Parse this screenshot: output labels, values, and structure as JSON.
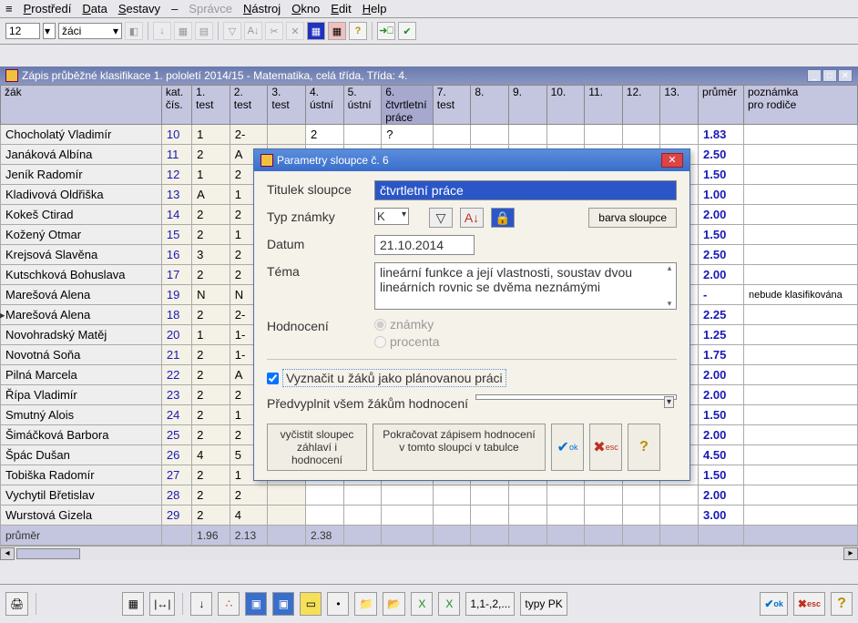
{
  "menu": [
    "Prostředí",
    "Data",
    "Sestavy",
    "–",
    "Správce",
    "Nástroj",
    "Okno",
    "Edit",
    "Help"
  ],
  "toolbar": {
    "num": "12",
    "drop": "žáci"
  },
  "subwindow_title": "Zápis průběžné klasifikace 1. pololetí 2014/15 - Matematika, celá třída, Třída: 4.",
  "columns": [
    "žák",
    "kat. čís.",
    "1. test",
    "2. test",
    "3. test",
    "4. ústní",
    "5. ústní",
    "6. čtvrtletní práce",
    "7. test",
    "8.",
    "9.",
    "10.",
    "11.",
    "12.",
    "13.",
    "průměr",
    "poznámka pro rodiče"
  ],
  "rows": [
    {
      "name": "Chocholatý Vladimír",
      "kat": "10",
      "g": [
        "1",
        "2-",
        "",
        "2",
        "",
        "?",
        "",
        "",
        "",
        "",
        "",
        "",
        ""
      ],
      "avg": "1.83",
      "note": ""
    },
    {
      "name": "Janáková Albína",
      "kat": "11",
      "g": [
        "2",
        "A",
        "",
        "",
        "",
        "",
        "",
        "",
        "",
        "",
        "",
        "",
        ""
      ],
      "avg": "2.50",
      "note": ""
    },
    {
      "name": "Jeník Radomír",
      "kat": "12",
      "g": [
        "1",
        "2",
        "",
        "",
        "",
        "",
        "",
        "",
        "",
        "",
        "",
        "",
        ""
      ],
      "avg": "1.50",
      "note": ""
    },
    {
      "name": "Kladivová Oldřiška",
      "kat": "13",
      "g": [
        "A",
        "1",
        "",
        "",
        "",
        "",
        "",
        "",
        "",
        "",
        "",
        "",
        ""
      ],
      "avg": "1.00",
      "note": ""
    },
    {
      "name": "Kokeš Ctirad",
      "kat": "14",
      "g": [
        "2",
        "2",
        "",
        "",
        "",
        "",
        "",
        "",
        "",
        "",
        "",
        "",
        ""
      ],
      "avg": "2.00",
      "note": ""
    },
    {
      "name": "Kožený Otmar",
      "kat": "15",
      "g": [
        "2",
        "1",
        "",
        "",
        "",
        "",
        "",
        "",
        "",
        "",
        "",
        "",
        ""
      ],
      "avg": "1.50",
      "note": ""
    },
    {
      "name": "Krejsová Slavěna",
      "kat": "16",
      "g": [
        "3",
        "2",
        "",
        "",
        "",
        "",
        "",
        "",
        "",
        "",
        "",
        "",
        ""
      ],
      "avg": "2.50",
      "note": ""
    },
    {
      "name": "Kutschková Bohuslava",
      "kat": "17",
      "g": [
        "2",
        "2",
        "",
        "",
        "",
        "",
        "",
        "",
        "",
        "",
        "",
        "",
        ""
      ],
      "avg": "2.00",
      "note": ""
    },
    {
      "name": "Marešová Alena",
      "kat": "19",
      "g": [
        "N",
        "N",
        "",
        "",
        "",
        "",
        "",
        "",
        "",
        "",
        "",
        "",
        ""
      ],
      "avg": "-",
      "note": "nebude klasifikována"
    },
    {
      "name": "Marešová Alena",
      "kat": "18",
      "g": [
        "2",
        "2-",
        "",
        "",
        "",
        "",
        "",
        "",
        "",
        "",
        "",
        "",
        ""
      ],
      "avg": "2.25",
      "note": ""
    },
    {
      "name": "Novohradský Matěj",
      "kat": "20",
      "g": [
        "1",
        "1-",
        "",
        "",
        "",
        "",
        "",
        "",
        "",
        "",
        "",
        "",
        ""
      ],
      "avg": "1.25",
      "note": ""
    },
    {
      "name": "Novotná Soňa",
      "kat": "21",
      "g": [
        "2",
        "1-",
        "",
        "",
        "",
        "",
        "",
        "",
        "",
        "",
        "",
        "",
        ""
      ],
      "avg": "1.75",
      "note": ""
    },
    {
      "name": "Pilná Marcela",
      "kat": "22",
      "g": [
        "2",
        "A",
        "",
        "",
        "",
        "",
        "",
        "",
        "",
        "",
        "",
        "",
        ""
      ],
      "avg": "2.00",
      "note": ""
    },
    {
      "name": "Řípa Vladimír",
      "kat": "23",
      "g": [
        "2",
        "2",
        "",
        "",
        "",
        "",
        "",
        "",
        "",
        "",
        "",
        "",
        ""
      ],
      "avg": "2.00",
      "note": ""
    },
    {
      "name": "Smutný Alois",
      "kat": "24",
      "g": [
        "2",
        "1",
        "",
        "",
        "",
        "",
        "",
        "",
        "",
        "",
        "",
        "",
        ""
      ],
      "avg": "1.50",
      "note": ""
    },
    {
      "name": "Šimáčková Barbora",
      "kat": "25",
      "g": [
        "2",
        "2",
        "",
        "",
        "",
        "",
        "",
        "",
        "",
        "",
        "",
        "",
        ""
      ],
      "avg": "2.00",
      "note": ""
    },
    {
      "name": "Špác Dušan",
      "kat": "26",
      "g": [
        "4",
        "5",
        "",
        "",
        "",
        "",
        "",
        "",
        "",
        "",
        "",
        "",
        ""
      ],
      "avg": "4.50",
      "note": ""
    },
    {
      "name": "Tobiška Radomír",
      "kat": "27",
      "g": [
        "2",
        "1",
        "",
        "",
        "",
        "",
        "",
        "",
        "",
        "",
        "",
        "",
        ""
      ],
      "avg": "1.50",
      "note": ""
    },
    {
      "name": "Vychytil Břetislav",
      "kat": "28",
      "g": [
        "2",
        "2",
        "",
        "",
        "",
        "",
        "",
        "",
        "",
        "",
        "",
        "",
        ""
      ],
      "avg": "2.00",
      "note": ""
    },
    {
      "name": "Wurstová Gizela",
      "kat": "29",
      "g": [
        "2",
        "4",
        "",
        "",
        "",
        "",
        "",
        "",
        "",
        "",
        "",
        "",
        ""
      ],
      "avg": "3.00",
      "note": ""
    }
  ],
  "avg_row": {
    "label": "průměr",
    "vals": [
      "",
      "1.96",
      "2.13",
      "",
      "2.38",
      "",
      "",
      "",
      "",
      "",
      "",
      "",
      "",
      ""
    ]
  },
  "dialog": {
    "title": "Parametry sloupce č. 6",
    "lbl_titulek": "Titulek sloupce",
    "val_titulek": "čtvrtletní práce",
    "lbl_typ": "Typ známky",
    "val_typ": "K",
    "btn_barva": "barva sloupce",
    "lbl_datum": "Datum",
    "val_datum": "21.10.2014",
    "lbl_tema": "Téma",
    "val_tema": "lineární funkce a její vlastnosti, soustav dvou lineárních rovnic se dvěma neznámými",
    "lbl_hodnoceni": "Hodnocení",
    "radio_znamky": "známky",
    "radio_procenta": "procenta",
    "chk_vyznacit": "Vyznačit u žáků jako plánovanou práci",
    "lbl_predvyplnit": "Předvyplnit všem žákům hodnocení",
    "btn_vycistit": "vyčistit sloupec záhlaví i hodnocení",
    "btn_pokracovat": "Pokračovat zápisem hodnocení v tomto sloupci v tabulce"
  },
  "status": {
    "range": "1,1-,2,...",
    "typy": "typy PK",
    "ok": "ok",
    "esc": "esc"
  }
}
